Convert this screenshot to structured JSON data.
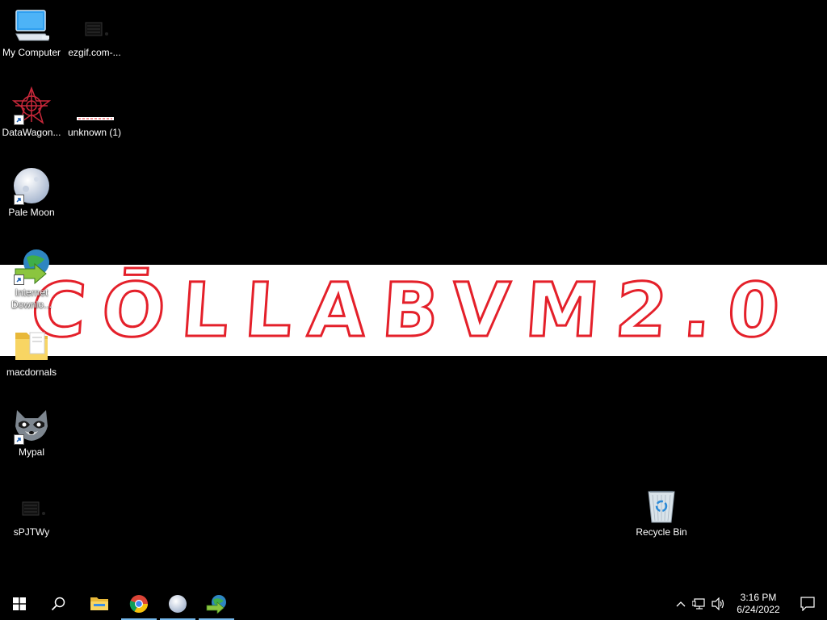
{
  "desktop": {
    "icons": [
      {
        "label": "My Computer"
      },
      {
        "label": "ezgif.com-..."
      },
      {
        "label": "DataWagon..."
      },
      {
        "label": "unknown (1)"
      },
      {
        "label": "Pale Moon"
      },
      {
        "label": "Internet Downlo..."
      },
      {
        "label": "macdornals"
      },
      {
        "label": "Mypal"
      },
      {
        "label": "sPJTWy"
      },
      {
        "label": "Recycle Bin"
      }
    ],
    "wallpaper_text": "CŌLLABVM2.0"
  },
  "taskbar": {
    "apps": [
      "start",
      "search",
      "file-explorer",
      "chrome",
      "pale-moon",
      "internet-download-manager"
    ],
    "time": "3:16 PM",
    "date": "6/24/2022"
  },
  "colors": {
    "banner_red": "#e4202a",
    "active_indicator": "#76b9ed"
  }
}
